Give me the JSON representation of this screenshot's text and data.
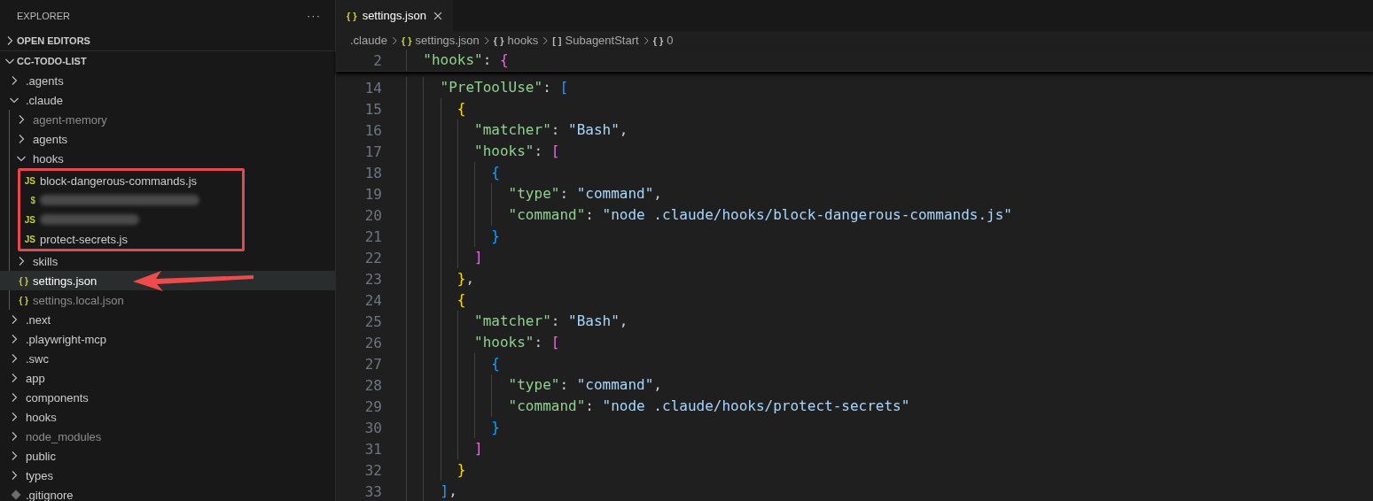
{
  "explorer": {
    "title": "EXPLORER",
    "more": "···",
    "sections": [
      {
        "label": "OPEN EDITORS",
        "expanded": false
      },
      {
        "label": "CC-TODO-LIST",
        "expanded": true,
        "items": [
          {
            "kind": "folder",
            "name": ".agents",
            "expanded": false,
            "selected": false,
            "ignored": false
          },
          {
            "kind": "folder",
            "name": ".claude",
            "expanded": true,
            "selected": false,
            "ignored": false,
            "children": [
              {
                "kind": "folder",
                "name": "agent-memory",
                "expanded": false,
                "selected": false,
                "ignored": true
              },
              {
                "kind": "folder",
                "name": "agents",
                "expanded": false,
                "selected": false,
                "ignored": false
              },
              {
                "kind": "folder",
                "name": "hooks",
                "expanded": true,
                "selected": false,
                "ignored": false,
                "highlighted": true,
                "children": [
                  {
                    "kind": "js",
                    "icon": "JS",
                    "name": "block-dangerous-commands.js",
                    "selected": false,
                    "ignored": false
                  },
                  {
                    "kind": "shell",
                    "icon": "$",
                    "blurred": true,
                    "selected": false,
                    "ignored": false
                  },
                  {
                    "kind": "js",
                    "icon": "JS",
                    "blurred": true,
                    "selected": false,
                    "ignored": false
                  },
                  {
                    "kind": "js",
                    "icon": "JS",
                    "name": "protect-secrets.js",
                    "selected": false,
                    "ignored": false
                  }
                ]
              },
              {
                "kind": "folder",
                "name": "skills",
                "expanded": false,
                "selected": false,
                "ignored": false
              },
              {
                "kind": "json",
                "icon": "{ }",
                "name": "settings.json",
                "selected": true,
                "ignored": false,
                "arrow": true
              },
              {
                "kind": "json",
                "icon": "{ }",
                "name": "settings.local.json",
                "selected": false,
                "ignored": true
              }
            ]
          },
          {
            "kind": "folder",
            "name": ".next",
            "expanded": false,
            "selected": false,
            "ignored": false
          },
          {
            "kind": "folder",
            "name": ".playwright-mcp",
            "expanded": false,
            "selected": false,
            "ignored": false
          },
          {
            "kind": "folder",
            "name": ".swc",
            "expanded": false,
            "selected": false,
            "ignored": false
          },
          {
            "kind": "folder",
            "name": "app",
            "expanded": false,
            "selected": false,
            "ignored": false
          },
          {
            "kind": "folder",
            "name": "components",
            "expanded": false,
            "selected": false,
            "ignored": false
          },
          {
            "kind": "folder",
            "name": "hooks",
            "expanded": false,
            "selected": false,
            "ignored": false
          },
          {
            "kind": "folder",
            "name": "node_modules",
            "expanded": false,
            "selected": false,
            "ignored": true
          },
          {
            "kind": "folder",
            "name": "public",
            "expanded": false,
            "selected": false,
            "ignored": false
          },
          {
            "kind": "folder",
            "name": "types",
            "expanded": false,
            "selected": false,
            "ignored": false
          },
          {
            "kind": "gitignore",
            "name": ".gitignore",
            "selected": false,
            "ignored": false
          }
        ]
      }
    ]
  },
  "tabs": [
    {
      "icon": "{ }",
      "label": "settings.json",
      "selected": true
    }
  ],
  "breadcrumbs": [
    {
      "label": ".claude"
    },
    {
      "kind": "file",
      "icon": "{ }",
      "label": "settings.json"
    },
    {
      "kind": "symbol",
      "icon": "{ }",
      "label": "hooks"
    },
    {
      "kind": "symbol",
      "icon": "[ ]",
      "label": "SubagentStart"
    },
    {
      "kind": "symbol",
      "icon": "{ }",
      "label": "0"
    }
  ],
  "sticky_lines": [
    {
      "number": "2",
      "tokens": [
        {
          "kind": "key",
          "text": "  \"hooks\""
        },
        {
          "kind": "punct",
          "text": ": "
        },
        {
          "kind": "bracket2",
          "text": "{"
        }
      ]
    }
  ],
  "lines": [
    {
      "number": "14",
      "tokens": [
        {
          "kind": "key",
          "text": "    \"PreToolUse\""
        },
        {
          "kind": "punct",
          "text": ": "
        },
        {
          "kind": "bracket3",
          "text": "["
        }
      ]
    },
    {
      "number": "15",
      "tokens": [
        {
          "kind": "bracket1",
          "text": "      {"
        }
      ]
    },
    {
      "number": "16",
      "tokens": [
        {
          "kind": "key",
          "text": "        \"matcher\""
        },
        {
          "kind": "punct",
          "text": ": "
        },
        {
          "kind": "string",
          "text": "\"Bash\""
        },
        {
          "kind": "punct",
          "text": ","
        }
      ]
    },
    {
      "number": "17",
      "tokens": [
        {
          "kind": "key",
          "text": "        \"hooks\""
        },
        {
          "kind": "punct",
          "text": ": "
        },
        {
          "kind": "bracket2",
          "text": "["
        }
      ]
    },
    {
      "number": "18",
      "tokens": [
        {
          "kind": "bracket3",
          "text": "          {"
        }
      ]
    },
    {
      "number": "19",
      "tokens": [
        {
          "kind": "key",
          "text": "            \"type\""
        },
        {
          "kind": "punct",
          "text": ": "
        },
        {
          "kind": "string",
          "text": "\"command\""
        },
        {
          "kind": "punct",
          "text": ","
        }
      ]
    },
    {
      "number": "20",
      "tokens": [
        {
          "kind": "key",
          "text": "            \"command\""
        },
        {
          "kind": "punct",
          "text": ": "
        },
        {
          "kind": "string",
          "text": "\"node .claude/hooks/block-dangerous-commands.js\""
        }
      ]
    },
    {
      "number": "21",
      "tokens": [
        {
          "kind": "bracket3",
          "text": "          }"
        }
      ]
    },
    {
      "number": "22",
      "tokens": [
        {
          "kind": "bracket2",
          "text": "        ]"
        }
      ]
    },
    {
      "number": "23",
      "tokens": [
        {
          "kind": "bracket1",
          "text": "      }"
        },
        {
          "kind": "punct",
          "text": ","
        }
      ]
    },
    {
      "number": "24",
      "tokens": [
        {
          "kind": "bracket1",
          "text": "      {"
        }
      ]
    },
    {
      "number": "25",
      "tokens": [
        {
          "kind": "key",
          "text": "        \"matcher\""
        },
        {
          "kind": "punct",
          "text": ": "
        },
        {
          "kind": "string",
          "text": "\"Bash\""
        },
        {
          "kind": "punct",
          "text": ","
        }
      ]
    },
    {
      "number": "26",
      "tokens": [
        {
          "kind": "key",
          "text": "        \"hooks\""
        },
        {
          "kind": "punct",
          "text": ": "
        },
        {
          "kind": "bracket2",
          "text": "["
        }
      ]
    },
    {
      "number": "27",
      "tokens": [
        {
          "kind": "bracket3",
          "text": "          {"
        }
      ]
    },
    {
      "number": "28",
      "tokens": [
        {
          "kind": "key",
          "text": "            \"type\""
        },
        {
          "kind": "punct",
          "text": ": "
        },
        {
          "kind": "string",
          "text": "\"command\""
        },
        {
          "kind": "punct",
          "text": ","
        }
      ]
    },
    {
      "number": "29",
      "tokens": [
        {
          "kind": "key",
          "text": "            \"command\""
        },
        {
          "kind": "punct",
          "text": ": "
        },
        {
          "kind": "string",
          "text": "\"node .claude/hooks/protect-secrets\""
        }
      ]
    },
    {
      "number": "30",
      "tokens": [
        {
          "kind": "bracket3",
          "text": "          }"
        }
      ]
    },
    {
      "number": "31",
      "tokens": [
        {
          "kind": "bracket2",
          "text": "        ]"
        }
      ]
    },
    {
      "number": "32",
      "tokens": [
        {
          "kind": "bracket1",
          "text": "      }"
        }
      ]
    },
    {
      "number": "33",
      "tokens": [
        {
          "kind": "bracket3",
          "text": "    ]"
        },
        {
          "kind": "punct",
          "text": ","
        }
      ]
    }
  ]
}
